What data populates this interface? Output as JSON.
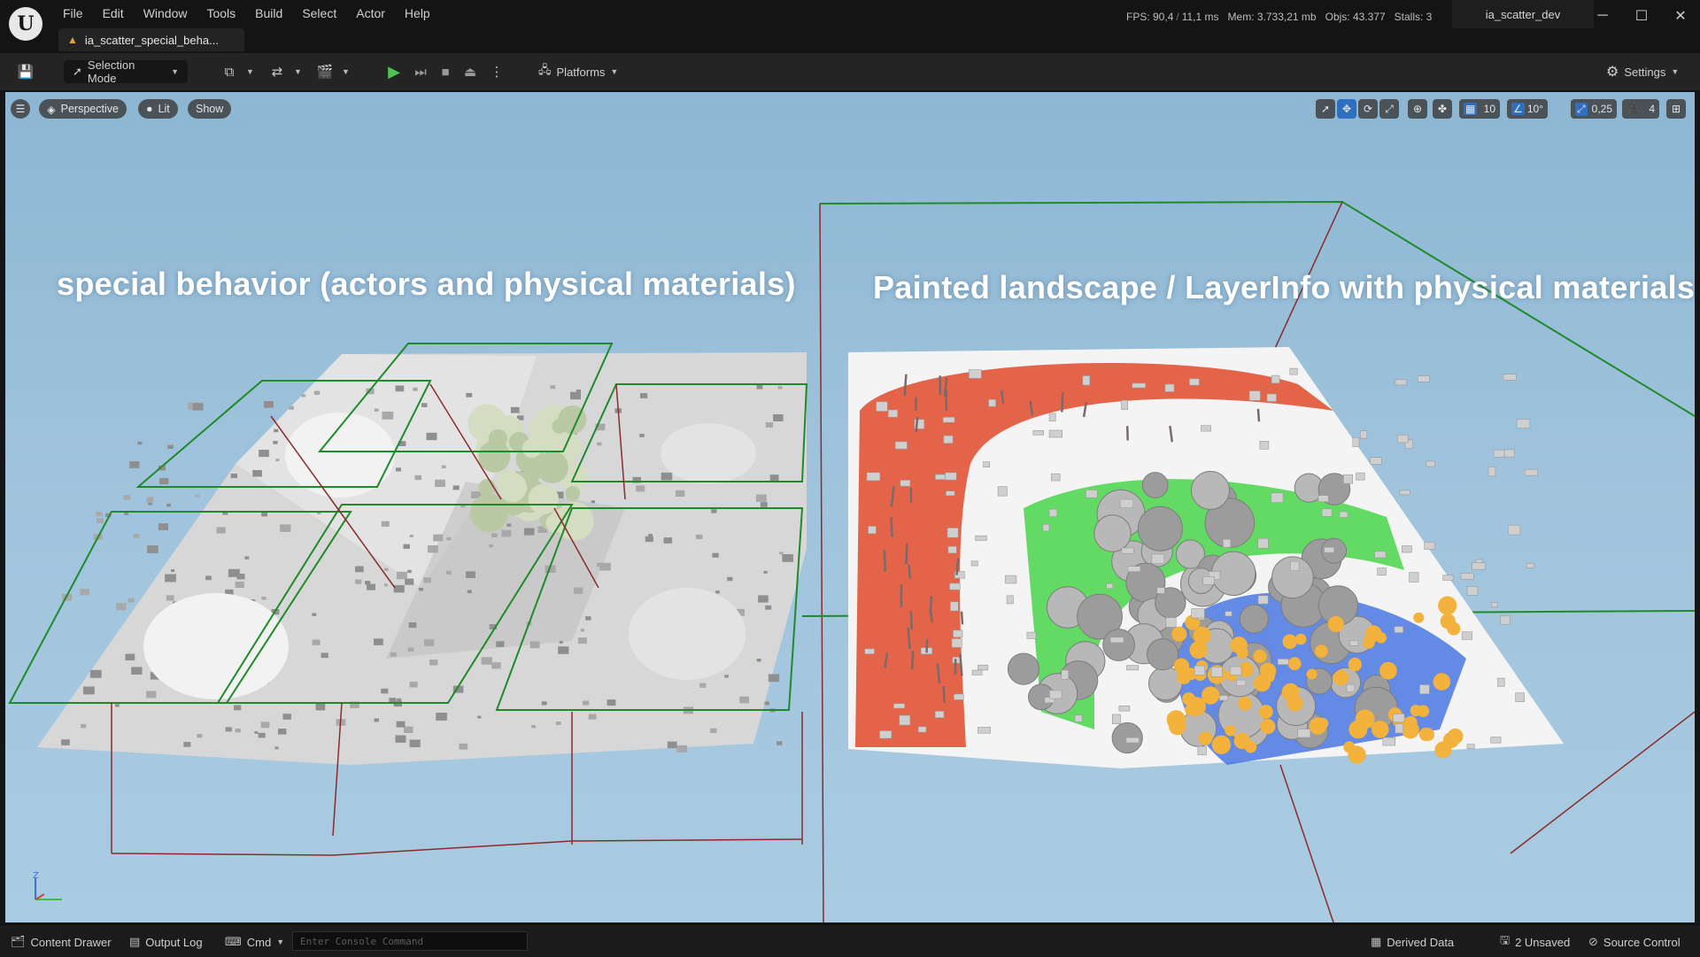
{
  "menus": [
    "File",
    "Edit",
    "Window",
    "Tools",
    "Build",
    "Select",
    "Actor",
    "Help"
  ],
  "level_tab": {
    "name": "ia_scatter_special_beha..."
  },
  "stats": {
    "fps": "FPS: 90,4",
    "frame_ms": "11,1 ms",
    "mem": "Mem: 3.733,21 mb",
    "objs": "Objs: 43.377",
    "stalls": "Stalls: 3"
  },
  "project_name": "ia_scatter_dev",
  "toolbar": {
    "selection_mode": "Selection Mode",
    "platforms": "Platforms",
    "settings": "Settings"
  },
  "viewport": {
    "perspective": "Perspective",
    "lit": "Lit",
    "show": "Show",
    "grid_snap": "10",
    "rotation_snap": "10°",
    "scale_snap": "0,25",
    "camera_speed": "4",
    "caption_left": "special behavior (actors and physical materials)",
    "caption_right": "Painted landscape / LayerInfo with physical materials",
    "axis_label": "Z"
  },
  "statusbar": {
    "content_drawer": "Content Drawer",
    "output_log": "Output Log",
    "cmd": "Cmd",
    "console_placeholder": "Enter Console Command",
    "derived_data": "Derived Data",
    "unsaved": "2 Unsaved",
    "source_control": "Source Control"
  },
  "colors": {
    "accent": "#2f6fbf",
    "play_green": "#4fc24f",
    "layer_red": "#e04a2a",
    "layer_green": "#3fd33f",
    "layer_blue": "#3f6fe0",
    "duck_yellow": "#f2b23c"
  }
}
